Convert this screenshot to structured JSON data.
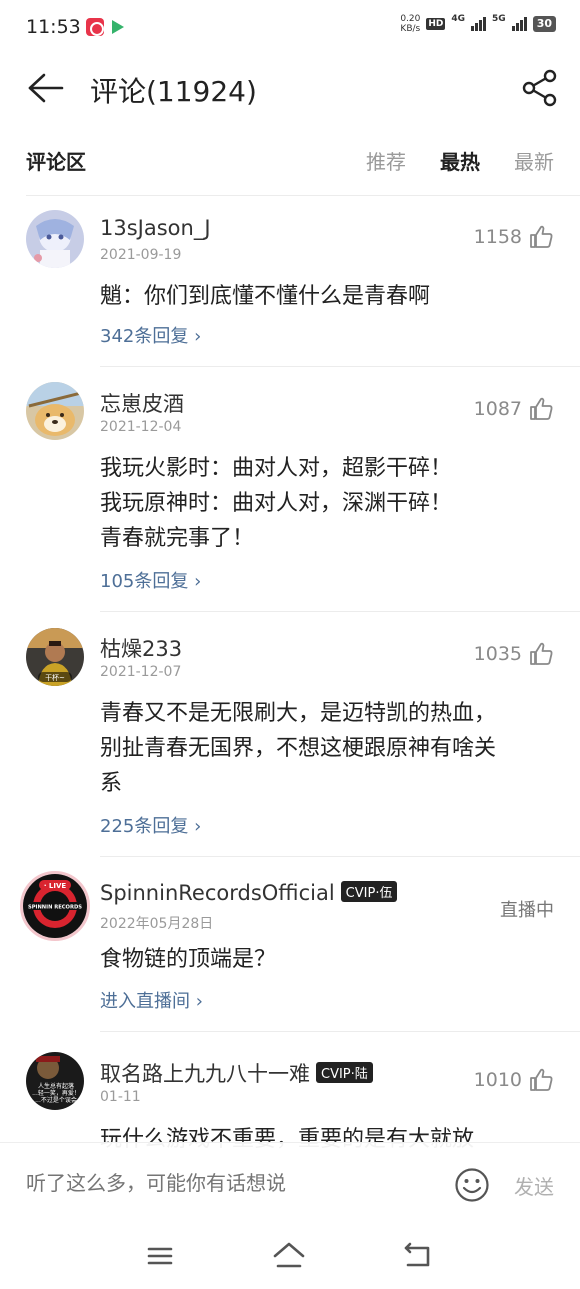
{
  "status_bar": {
    "time": "11:53",
    "speed_value": "0.20",
    "speed_unit": "KB/s",
    "hd_label": "HD",
    "net_4g": "4G",
    "net_5g": "5G",
    "battery": "30"
  },
  "header": {
    "title": "评论(11924)",
    "back_icon": "arrow-left-icon",
    "share_icon": "share-icon"
  },
  "section": {
    "label": "评论区",
    "tabs": [
      {
        "label": "推荐",
        "active": false
      },
      {
        "label": "最热",
        "active": true
      },
      {
        "label": "最新",
        "active": false
      }
    ]
  },
  "comments": [
    {
      "username": "13sJason_J",
      "date": "2021-09-19",
      "likes": "1158",
      "text": "魈：你们到底懂不懂什么是青春啊",
      "replies": "342条回复"
    },
    {
      "username": "忘崽皮酒",
      "date": "2021-12-04",
      "likes": "1087",
      "text_lines": [
        "我玩火影时：曲对人对，超影干碎！",
        "我玩原神时：曲对人对，深渊干碎！",
        "青春就完事了！"
      ],
      "replies": "105条回复"
    },
    {
      "username": "枯燥233",
      "date": "2021-12-07",
      "likes": "1035",
      "avatar_text": "干杯~",
      "text_lines": [
        "青春又不是无限刷大，是迈特凯的热血，",
        "别扯青春无国界，不想这梗跟原神有啥关",
        "系"
      ],
      "replies": "225条回复"
    },
    {
      "username": "SpinninRecordsOfficial",
      "vip": "CVIP·伍",
      "date": "2022年05月28日",
      "status": "直播中",
      "avatar_badge": "· LIVE",
      "avatar_text": "SPINNIN RECORDS",
      "text": "食物链的顶端是？",
      "link": "进入直播间"
    },
    {
      "username": "取名路上九九八十一难",
      "vip": "CVIP·陆",
      "date": "01-11",
      "likes": "1010",
      "avatar_text_lines": [
        "人生总有起落",
        "...轻一笑，再爱！",
        "...不过是个误会"
      ],
      "text": "玩什么游戏不重要，重要的是有大就放"
    }
  ],
  "input_bar": {
    "placeholder": "听了这么多，可能你有话想说",
    "send_label": "发送",
    "emoji_icon": "smile-icon"
  },
  "nav_bar": {
    "icons": [
      "menu-icon",
      "home-icon",
      "back-icon"
    ]
  },
  "colors": {
    "link": "#4e6f97",
    "muted": "#9a9a9a",
    "text": "#222222"
  }
}
